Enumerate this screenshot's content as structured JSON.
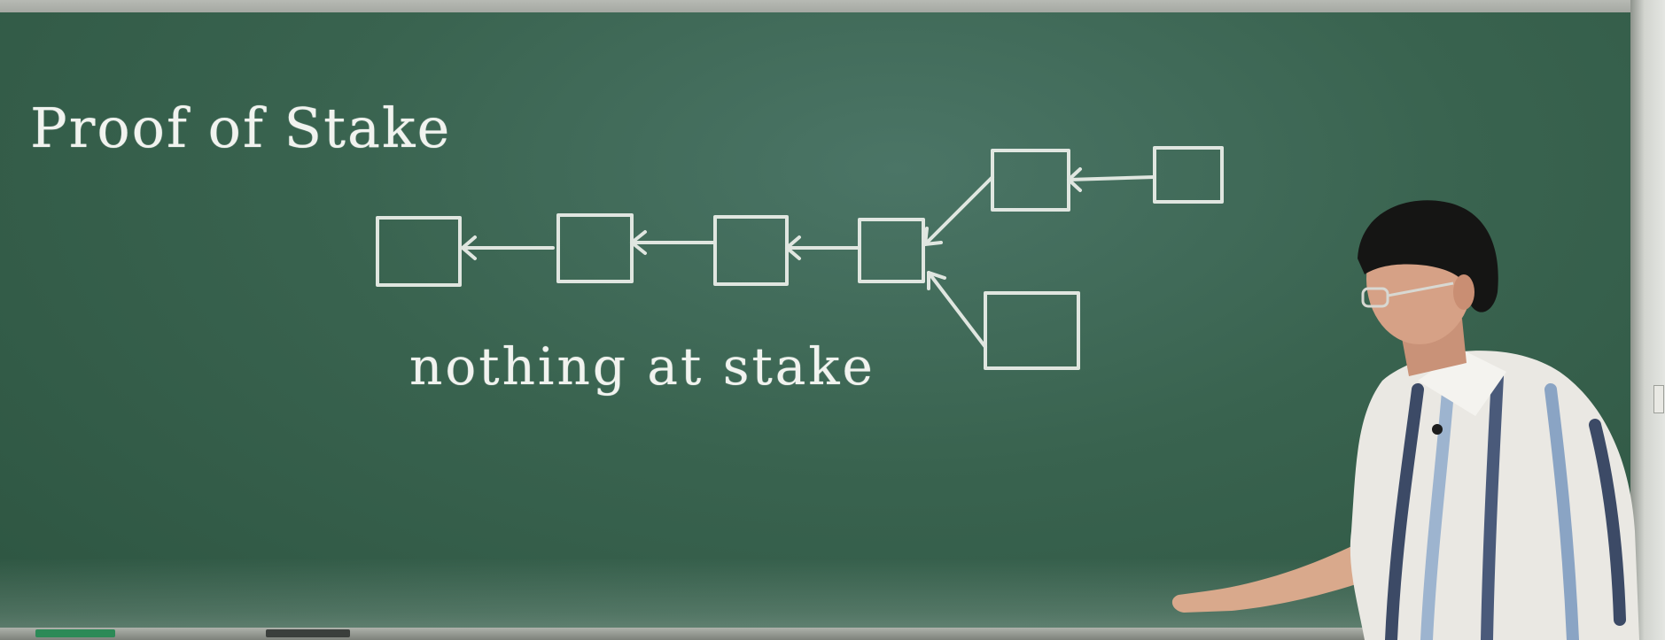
{
  "board": {
    "title": "Proof of Stake",
    "caption": "nothing at stake"
  },
  "diagram": {
    "main_chain_blocks": 4,
    "upper_fork_blocks": 2,
    "lower_fork_blocks": 1,
    "arrow_direction": "newer block points to previous block"
  },
  "colors": {
    "chalkboard": "#39634f",
    "chalk": "#f1f3ef",
    "frame": "#c9ccc6"
  }
}
